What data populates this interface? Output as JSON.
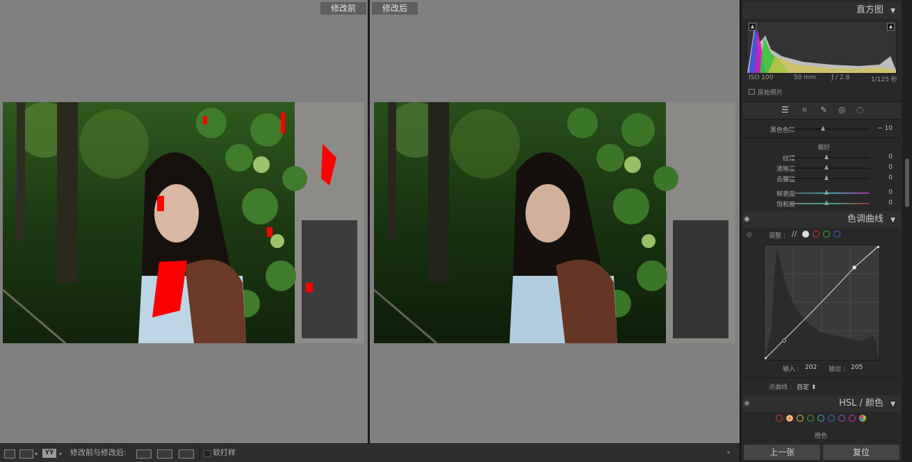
{
  "compare": {
    "before_label": "修改前",
    "after_label": "修改后"
  },
  "toolbar": {
    "view_mode_label": "YY",
    "compare_label": "修改前与修改后:",
    "softproof_label": "软打样"
  },
  "histogram": {
    "title": "直方图",
    "iso": "ISO 100",
    "focal": "50 mm",
    "aperture": "ƒ / 2.8",
    "shutter": "1/125 秒",
    "original_photo_label": "原始照片"
  },
  "basic": {
    "blacks_label": "黑色色阶",
    "blacks_value": "− 10",
    "presence_title": "偏好",
    "sliders": [
      {
        "label": "纹理",
        "value": "0"
      },
      {
        "label": "清晰度",
        "value": "0"
      },
      {
        "label": "去朦胧",
        "value": "0"
      },
      {
        "label": "鲜艳度",
        "value": "0"
      },
      {
        "label": "饱和度",
        "value": "0"
      }
    ]
  },
  "tone_curve": {
    "title": "色调曲线",
    "adjust_label": "调整 :",
    "input_label": "输入 :",
    "input_value": "202",
    "output_label": "输出 :",
    "output_value": "205",
    "point_curve_label": "点曲线 :",
    "point_curve_value": "自定 ⬍"
  },
  "hsl": {
    "title": "HSL / 颜色",
    "subtab": "橙色",
    "colors": [
      "#d23b3b",
      "#e08a2c",
      "#d9c43a",
      "#3faa45",
      "#36b3b3",
      "#3f6fd6",
      "#9a4fd1",
      "#c93fae"
    ]
  },
  "buttons": {
    "prev": "上一张",
    "reset": "复位"
  }
}
